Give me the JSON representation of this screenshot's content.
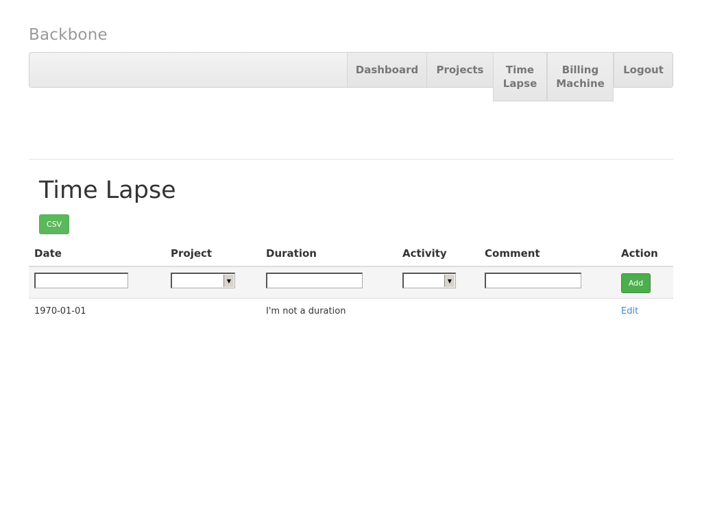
{
  "brand": "Backbone",
  "nav": {
    "dashboard": "Dashboard",
    "projects": "Projects",
    "time_lapse_line1": "Time",
    "time_lapse_line2": "Lapse",
    "billing_line1": "Billing",
    "billing_line2": "Machine",
    "logout": "Logout"
  },
  "page": {
    "title": "Time Lapse",
    "csv_label": "CSV"
  },
  "table": {
    "columns": [
      "Date",
      "Project",
      "Duration",
      "Activity",
      "Comment",
      "Action"
    ],
    "filter": {
      "date_value": "",
      "project_selected": "",
      "duration_value": "",
      "activity_selected": "",
      "comment_value": "",
      "add_label": "Add"
    },
    "rows": [
      {
        "date": "1970-01-01",
        "project": "",
        "duration": "I'm not a duration",
        "activity": "",
        "comment": "",
        "action": "Edit"
      }
    ]
  },
  "colors": {
    "accent_green": "#5cb85c",
    "link_blue": "#428bca"
  }
}
